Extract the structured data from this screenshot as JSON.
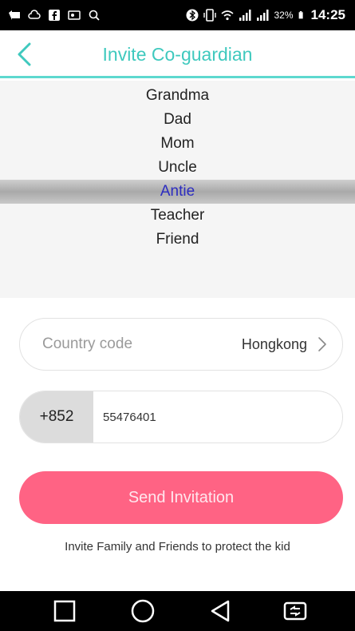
{
  "status_bar": {
    "battery_percent": "32%",
    "time": "14:25",
    "icons": [
      "message-icon",
      "cloud-icon",
      "facebook-icon",
      "gallery-icon",
      "search-icon",
      "bluetooth-icon",
      "vibrate-icon",
      "wifi-icon",
      "signal-icon",
      "signal-icon-2",
      "battery-icon"
    ]
  },
  "header": {
    "title": "Invite Co-guardian",
    "back_icon": "chevron-left-icon",
    "accent_color": "#3fc9be"
  },
  "picker": {
    "options": [
      "Grandma",
      "Dad",
      "Mom",
      "Uncle",
      "Antie",
      "Teacher",
      "Friend"
    ],
    "selected": "Antie",
    "selected_color": "#2c2cc0"
  },
  "country": {
    "label": "Country code",
    "value": "Hongkong",
    "icon": "chevron-right-icon"
  },
  "phone": {
    "dial_code": "+852",
    "number": "55476401"
  },
  "send_button": {
    "label": "Send Invitation",
    "color": "#ff6384"
  },
  "footer": {
    "note": "Invite Family and Friends to protect the kid"
  },
  "nav_bar": {
    "icons": [
      "recent-apps-icon",
      "home-icon",
      "back-icon",
      "switch-sim-icon"
    ]
  }
}
